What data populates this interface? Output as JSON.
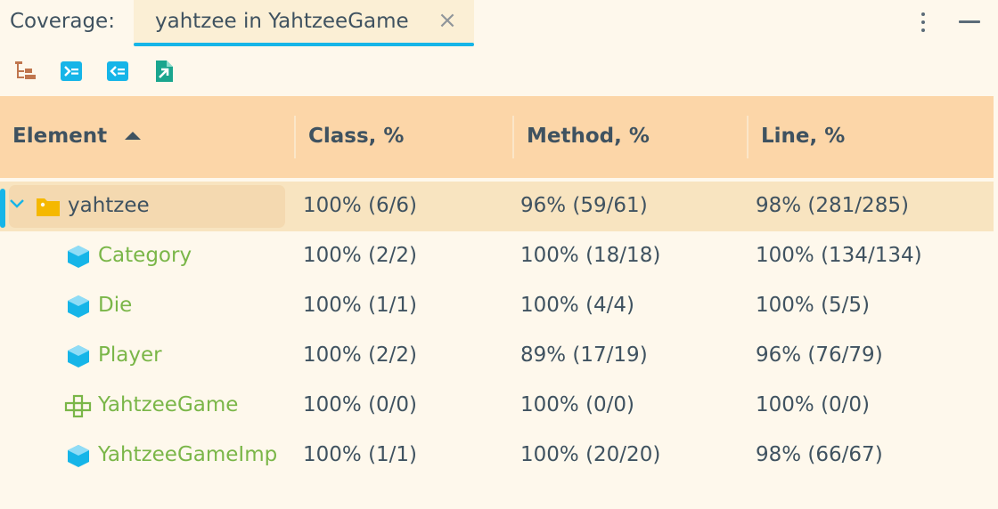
{
  "header": {
    "tool_label": "Coverage:",
    "tab_title": "yahtzee in YahtzeeGame",
    "close_glyph": "×"
  },
  "toolbar": {
    "buttons": [
      {
        "icon": "flatten-packages-icon"
      },
      {
        "icon": "navigate-to-source-icon"
      },
      {
        "icon": "navigate-from-source-icon"
      },
      {
        "icon": "export-report-icon"
      }
    ]
  },
  "table": {
    "columns": [
      "Element",
      "Class, %",
      "Method, %",
      "Line, %"
    ],
    "sort": {
      "column": "Element",
      "direction": "ascending"
    },
    "rows": [
      {
        "name": "yahtzee",
        "type": "package",
        "class": "100% (6/6)",
        "method": "96% (59/61)",
        "line": "98% (281/285)"
      },
      {
        "name": "Category",
        "type": "class",
        "class": "100% (2/2)",
        "method": "100% (18/18)",
        "line": "100% (134/134)"
      },
      {
        "name": "Die",
        "type": "class",
        "class": "100% (1/1)",
        "method": "100% (4/4)",
        "line": "100% (5/5)"
      },
      {
        "name": "Player",
        "type": "class",
        "class": "100% (2/2)",
        "method": "89% (17/19)",
        "line": "96% (76/79)"
      },
      {
        "name": "YahtzeeGame",
        "type": "interface",
        "class": "100% (0/0)",
        "method": "100% (0/0)",
        "line": "100% (0/0)"
      },
      {
        "name": "YahtzeeGameImp",
        "type": "class",
        "class": "100% (1/1)",
        "method": "100% (20/20)",
        "line": "98% (66/67)"
      }
    ]
  },
  "colors": {
    "accent": "#16b5e8",
    "header_bg": "#fcd6a8",
    "class_name": "#7ab648",
    "package_icon": "#f5b800"
  }
}
